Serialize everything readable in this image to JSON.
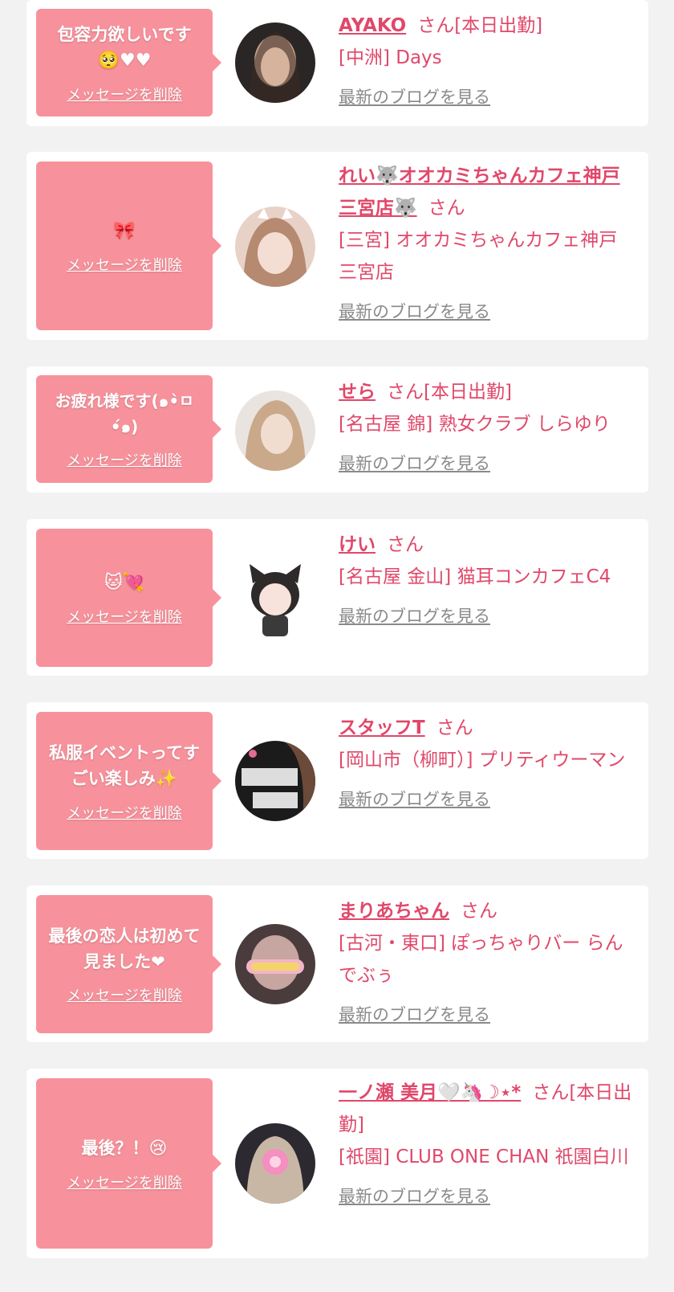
{
  "common": {
    "delete_label": "メッセージを削除",
    "blog_label": "最新のブログを見る",
    "san": "さん"
  },
  "colors": {
    "accent": "#e0486a",
    "bubble": "#f7929c",
    "link_gray": "#8a8a8a",
    "background": "#f2f2f2"
  },
  "entries": [
    {
      "message": "包容力欲しいです",
      "message_emoji": "🥺♥♥",
      "name": "AYAKO",
      "suffix": "さん[本日出勤]",
      "shop": "[中洲] Days"
    },
    {
      "message": "",
      "message_emoji": "🎀",
      "name": "れい🐺オオカミちゃんカフェ神戸三宮店🐺",
      "suffix": "さん",
      "shop": "[三宮] オオカミちゃんカフェ神戸三宮店"
    },
    {
      "message": "お疲れ様です(๑•̀ㅁ•́๑)",
      "message_emoji": "",
      "name": "せら",
      "suffix": "さん[本日出勤]",
      "shop": "[名古屋 錦] 熟女クラブ しらゆり"
    },
    {
      "message": "",
      "message_emoji": "🐱💘",
      "name": "けい",
      "suffix": "さん",
      "shop": "[名古屋 金山] 猫耳コンカフェC4"
    },
    {
      "message": "私服イベントってすごい楽しみ",
      "message_emoji": "✨",
      "name": "スタッフT",
      "suffix": "さん",
      "shop": "[岡山市（柳町）] プリティウーマン"
    },
    {
      "message": "最後の恋人は初めて見ました❤",
      "message_emoji": "",
      "name": "まりあちゃん",
      "suffix": "さん",
      "shop": "[古河・東口] ぽっちゃりバー らんでぶぅ"
    },
    {
      "message": "最後？！",
      "message_emoji": "😢",
      "name": "一ノ瀬 美月🤍🦄☽⋆*",
      "suffix": "さん[本日出勤]",
      "shop": "[祇園] CLUB ONE CHAN 祇園白川"
    }
  ]
}
